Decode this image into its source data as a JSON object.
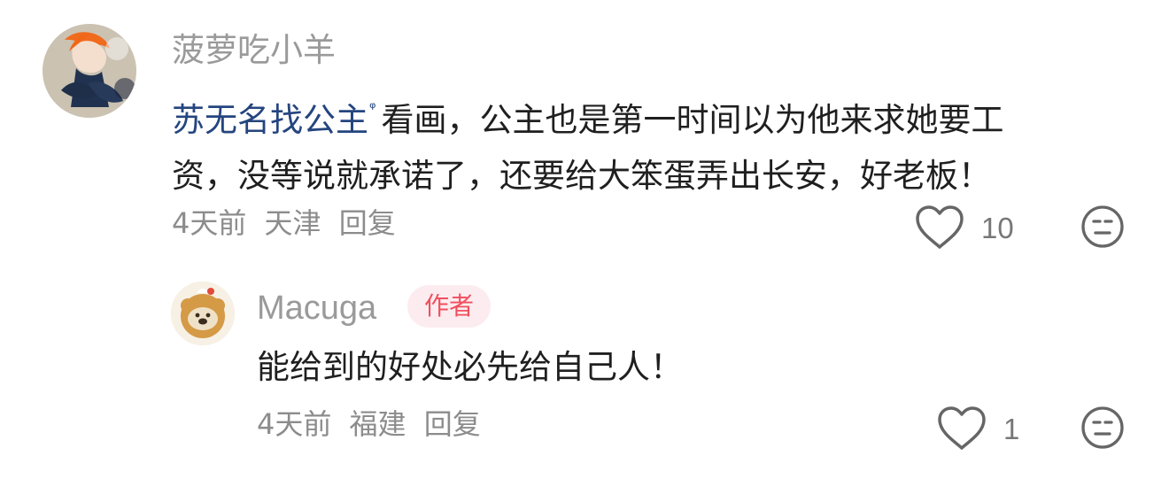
{
  "comment": {
    "author": "菠萝吃小羊",
    "mention": "苏无名找公主",
    "mention_marker": "ᵠ",
    "text_line_1": "看画，公主也是第一时间以为他来求她要工",
    "text_line_2": "资，没等说就承诺了，还要给大笨蛋弄出长安，好老板！",
    "time": "4天前",
    "location": "天津",
    "reply_label": "回复",
    "like_count": "10",
    "icons": {
      "avatar": "avatar-icon",
      "like": "heart-icon",
      "dislike": "dislike-face-icon"
    }
  },
  "reply": {
    "author": "Macuga",
    "badge": "作者",
    "text": "能给到的好处必先给自己人！",
    "time": "4天前",
    "location": "福建",
    "reply_label": "回复",
    "like_count": "1",
    "icons": {
      "avatar": "avatar-icon",
      "like": "heart-icon",
      "dislike": "dislike-face-icon"
    }
  },
  "colors": {
    "link": "#24457f",
    "badge_text": "#ef4f5f",
    "badge_background": "#fdecef",
    "muted": "#8c8c8c"
  }
}
